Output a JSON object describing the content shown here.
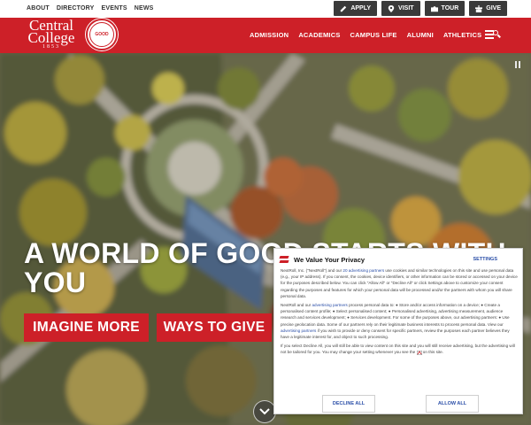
{
  "utility": {
    "links": [
      "ABOUT",
      "DIRECTORY",
      "EVENTS",
      "NEWS"
    ],
    "buttons": [
      {
        "label": "APPLY",
        "icon": "pencil-icon"
      },
      {
        "label": "VISIT",
        "icon": "map-pin-icon"
      },
      {
        "label": "TOUR",
        "icon": "camera-icon"
      },
      {
        "label": "GIVE",
        "icon": "gift-icon"
      }
    ]
  },
  "header": {
    "logo_line1": "Central",
    "logo_line2": "College",
    "logo_year": "1853",
    "seal_text": "GOOD",
    "nav": [
      "ADMISSION",
      "ACADEMICS",
      "CAMPUS LIFE",
      "ALUMNI",
      "ATHLETICS"
    ],
    "menu_icon": "menu-search-icon",
    "brand_color": "#cd2028"
  },
  "hero": {
    "headline": "A WORLD OF GOOD STARTS WITH YOU",
    "cta_primary": "IMAGINE MORE",
    "cta_secondary": "WAYS TO GIVE",
    "pause_icon": "pause-icon",
    "scroll_icon": "chevron-down-icon"
  },
  "consent": {
    "title": "We Value Your Privacy",
    "settings_label": "SETTINGS",
    "p1_a": "NextRoll, Inc. (\"NextRoll\") and our ",
    "p1_link": "20 advertising partners",
    "p1_b": " use cookies and similar technologies on this site and use personal data (e.g., your IP address). If you consent, the cookies, device identifiers, or other information can be stored or accessed on your device for the purposes described below. You can click \"Allow All\" or \"Decline All\" or click Settings above to customize your consent regarding the purposes and features for which your personal data will be processed and/or the partners with whom you will share personal data.",
    "p2_a": "NextRoll and our ",
    "p2_link": "advertising partners",
    "p2_b": " process personal data to: ● Store and/or access information on a device; ● Create a personalised content profile; ● Select personalised content; ● Personalised advertising, advertising measurement, audience research and services development; ● Services development. For some of the purposes above, our advertising partners: ● Use precise geolocation data. Some of our partners rely on their legitimate business interests to process personal data. View our ",
    "p2_link2": "advertising partners",
    "p2_c": " if you wish to provide or deny consent for specific partners, review the purposes each partner believes they have a legitimate interest for, and object to such processing.",
    "p3": "If you select Decline All, you will still be able to view content on this site and you will still receive advertising, but the advertising will not be tailored for you. You may change your setting whenever you see the",
    "p3_end": "on this site.",
    "decline_label": "DECLINE ALL",
    "allow_label": "ALLOW ALL"
  }
}
